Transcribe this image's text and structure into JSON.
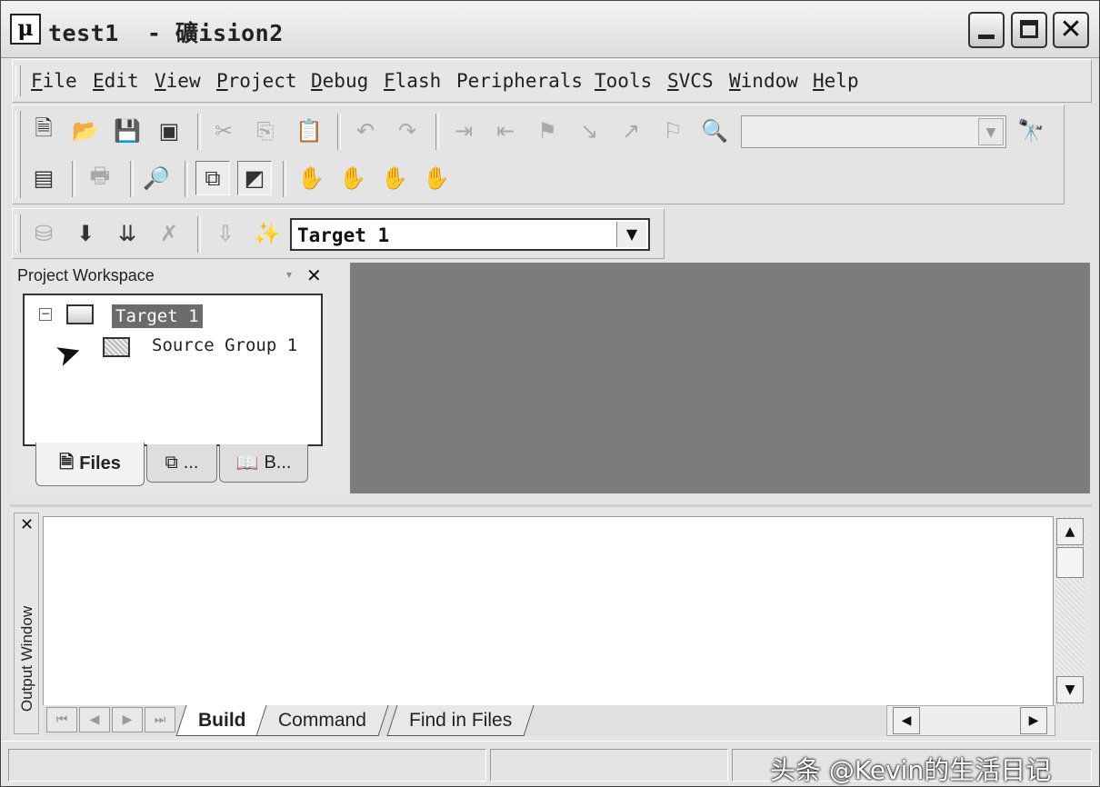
{
  "window": {
    "title": "test1  - 礦ision2",
    "app_icon_glyph": "μ",
    "controls": [
      "minimize",
      "maximize",
      "close"
    ]
  },
  "menu": [
    {
      "label_first": "F",
      "label_rest": "ile"
    },
    {
      "label_first": "E",
      "label_rest": "dit"
    },
    {
      "label_first": "V",
      "label_rest": "iew"
    },
    {
      "label_first": "P",
      "label_rest": "roject"
    },
    {
      "label_first": "D",
      "label_rest": "ebug"
    },
    {
      "label_first": "F",
      "label_rest": "lash"
    },
    {
      "label_first": "",
      "label_rest": "Peripherals"
    },
    {
      "label_first": "T",
      "label_rest": "ools"
    },
    {
      "label_first": "S",
      "label_rest": "VCS"
    },
    {
      "label_first": "W",
      "label_rest": "indow"
    },
    {
      "label_first": "H",
      "label_rest": "elp"
    }
  ],
  "toolbar_icons": {
    "row1": [
      "new-file-icon",
      "open-file-icon",
      "save-icon",
      "save-all-icon",
      "cut-icon",
      "copy-icon",
      "paste-icon",
      "undo-icon",
      "redo-icon",
      "indent-icon",
      "unindent-icon",
      "bookmark-icon",
      "next-bookmark-icon",
      "prev-bookmark-icon",
      "clear-bookmarks-icon",
      "find-in-files-icon",
      "find-icon"
    ],
    "row2": [
      "compile-icon",
      "print-icon",
      "zoom-icon",
      "workspace-toggle-icon",
      "output-toggle-icon",
      "stop-icon",
      "source-browser-icon",
      "breakpoint-icon",
      "debug-hand-icon"
    ],
    "row3": [
      "translate-icon",
      "build-target-icon",
      "rebuild-all-icon",
      "stop-build-icon",
      "load-icon",
      "target-options-icon"
    ]
  },
  "find_combo": {
    "value": ""
  },
  "target_select": {
    "value": "Target 1"
  },
  "workspace": {
    "title": "Project Workspace",
    "tree": {
      "root": "Target 1",
      "child": "Source Group 1"
    },
    "tabs": [
      {
        "label": "Files",
        "active": true
      },
      {
        "label": "...",
        "active": false
      },
      {
        "label": "B...",
        "active": false
      }
    ]
  },
  "output": {
    "side_label": "Output Window",
    "tabs": [
      {
        "label": "Build",
        "active": true
      },
      {
        "label": "Command",
        "active": false
      },
      {
        "label": "Find in Files",
        "active": false
      }
    ]
  },
  "watermark": "头条 @Kevin的生活日记"
}
